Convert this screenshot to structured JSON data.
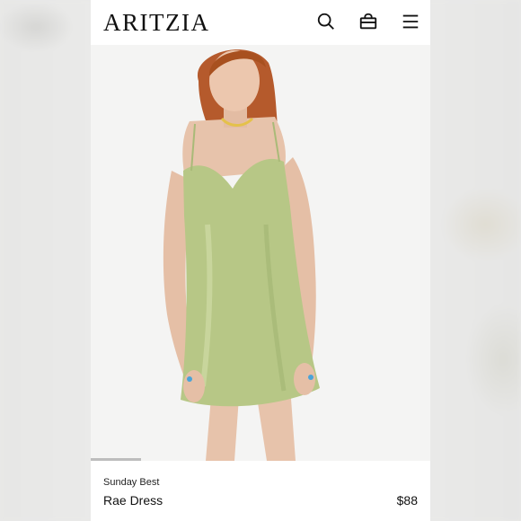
{
  "header": {
    "logo": "ARITZIA",
    "icons": [
      "search-icon",
      "shopping-bag-icon",
      "menu-icon"
    ]
  },
  "product": {
    "brand": "Sunday Best",
    "name": "Rae Dress",
    "price": "$88",
    "image_alt_color": "#b9c98a"
  },
  "colors": {
    "dress": "#b7c786",
    "skin": "#e7c3ab",
    "hair": "#b55a2c",
    "background": "#f4f4f3"
  }
}
